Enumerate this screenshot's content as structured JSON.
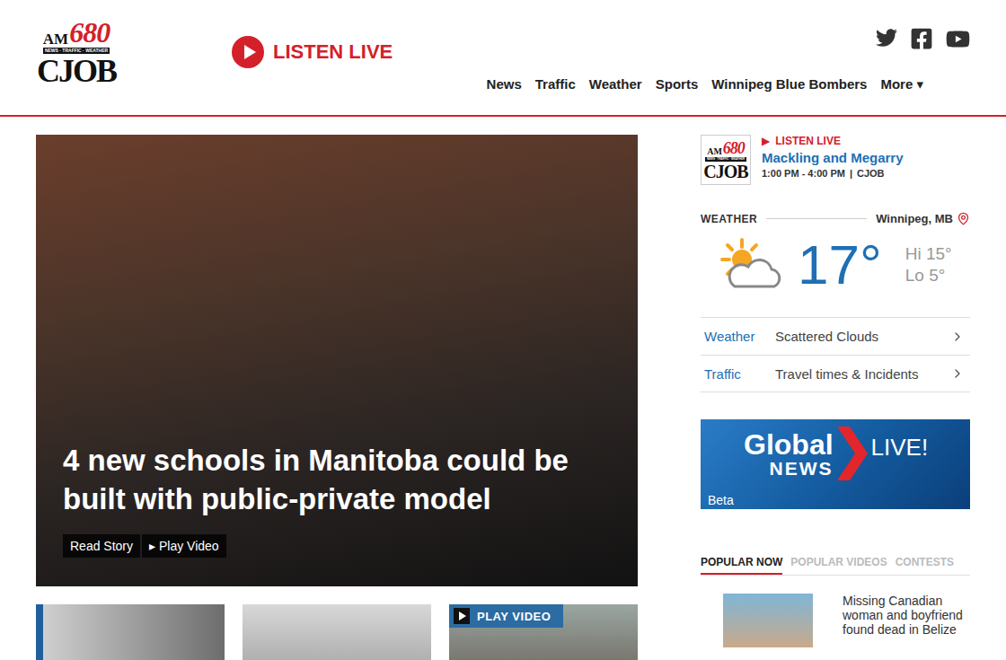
{
  "header": {
    "logo": {
      "am": "AM",
      "frequency": "680",
      "tagline": "NEWS · TRAFFIC · WEATHER",
      "call_sign": "CJOB"
    },
    "listen_live": "LISTEN LIVE",
    "nav": [
      {
        "label": "News",
        "selected": false
      },
      {
        "label": "Traffic",
        "selected": false
      },
      {
        "label": "Weather",
        "selected": false
      },
      {
        "label": "Sports",
        "selected": false
      },
      {
        "label": "Winnipeg Blue Bombers",
        "selected": false
      }
    ],
    "more": {
      "label": "More",
      "caret": "▾"
    }
  },
  "hero": {
    "headline": "4 new schools in Manitoba could be built with public-private model",
    "actions": [
      {
        "label": "Read Story",
        "icon": ""
      },
      {
        "label": "Play Video",
        "icon": "▸"
      }
    ]
  },
  "cards": [
    {
      "kind": "image",
      "badge": ""
    },
    {
      "kind": "image",
      "badge": ""
    },
    {
      "kind": "video",
      "badge": "PLAY VIDEO"
    }
  ],
  "now_playing": {
    "label": "LISTEN LIVE",
    "icon": "▶",
    "show": "Mackling and Megarry",
    "time": "1:00 PM - 4:00 PM",
    "separator": "|",
    "station": "CJOB"
  },
  "weather": {
    "heading": "WEATHER",
    "location": "Winnipeg, MB",
    "temperature": "17°",
    "high": "Hi 15°",
    "low": "Lo 5°",
    "links": [
      {
        "label": "Weather",
        "value": "Scattered Clouds"
      },
      {
        "label": "Traffic",
        "value": "Travel times & Incidents"
      }
    ]
  },
  "promo": {
    "brand": "Global",
    "sub": "NEWS",
    "live": "LIVE!",
    "tag": "Beta"
  },
  "tabs": [
    {
      "label": "POPULAR NOW",
      "selected": true
    },
    {
      "label": "POPULAR VIDEOS",
      "selected": false
    },
    {
      "label": "CONTESTS",
      "selected": false
    }
  ],
  "stories": [
    {
      "title": "Missing Canadian woman and boyfriend found dead in Belize"
    }
  ]
}
